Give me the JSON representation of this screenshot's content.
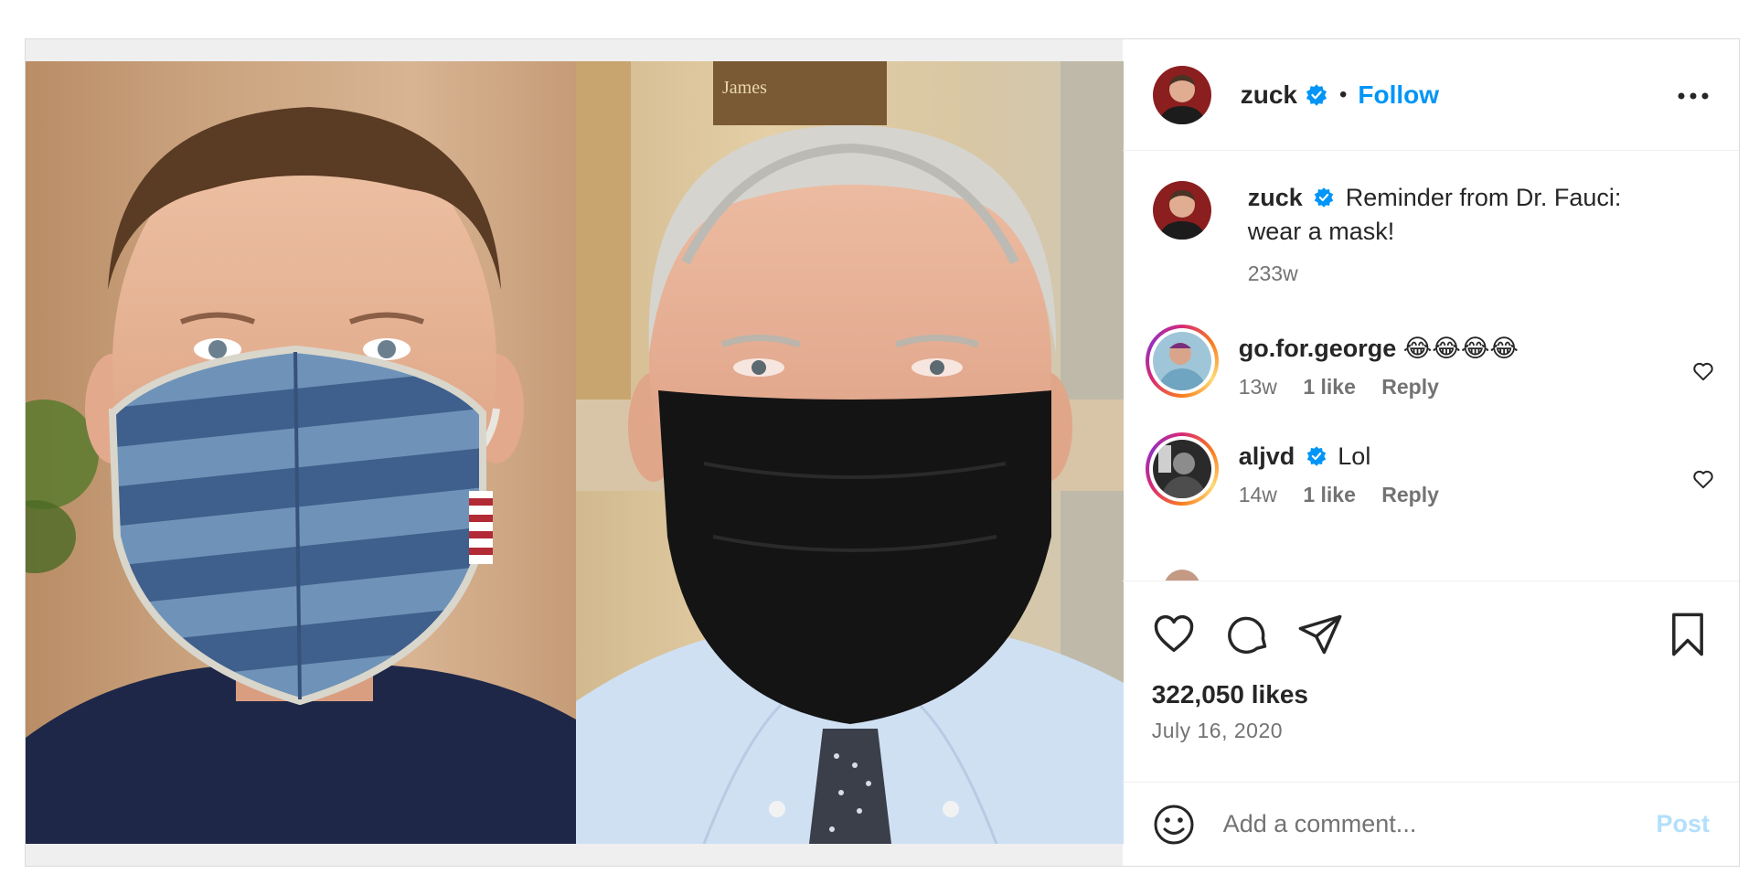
{
  "post": {
    "author": "zuck",
    "follow_label": "Follow",
    "separator": "•",
    "caption": {
      "username": "zuck",
      "text": "Reminder from Dr. Fauci: wear a mask!",
      "age": "233w"
    },
    "plaque_text": "James",
    "comments": [
      {
        "username": "go.for.george",
        "text": "😂😂😂😂",
        "age": "13w",
        "likes": "1 like",
        "reply": "Reply",
        "verified": false
      },
      {
        "username": "aljvd",
        "text": "Lol",
        "age": "14w",
        "likes": "1 like",
        "reply": "Reply",
        "verified": true
      }
    ],
    "likes_count": "322,050 likes",
    "date": "July 16, 2020",
    "add_comment_placeholder": "Add a comment...",
    "post_label": "Post"
  },
  "colors": {
    "accent": "#0095f6",
    "verified": "#0095f6",
    "post_disabled": "#b2dffc",
    "muted_text": "#737373"
  },
  "icons": [
    "more-icon",
    "verified-icon",
    "heart-icon",
    "comment-icon",
    "share-icon",
    "bookmark-icon",
    "emoji-icon"
  ]
}
